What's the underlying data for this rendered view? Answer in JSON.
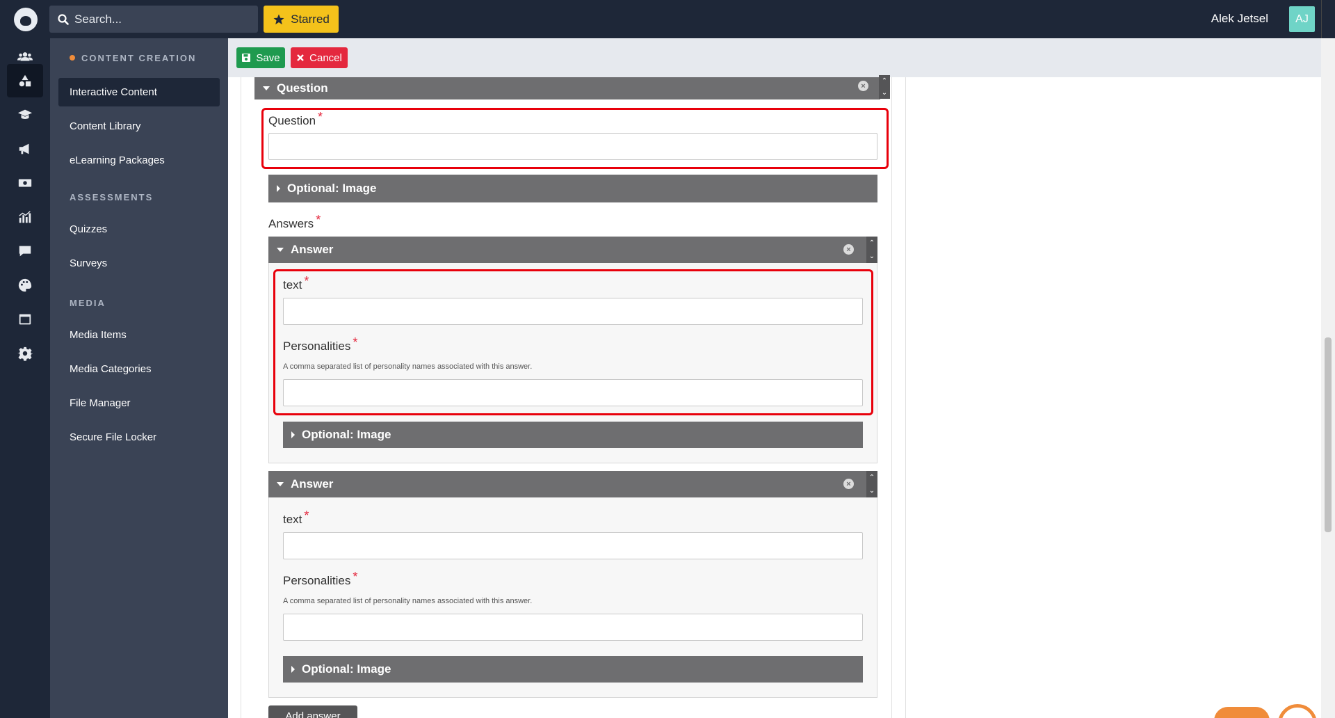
{
  "topbar": {
    "search_placeholder": "Search...",
    "starred_label": "Starred",
    "user_name": "Alek Jetsel",
    "user_initials": "AJ"
  },
  "rail": {
    "icons": [
      "users-icon",
      "shapes-icon",
      "graduation-cap-icon",
      "megaphone-icon",
      "money-icon",
      "chart-icon",
      "chat-icon",
      "palette-icon",
      "window-icon",
      "gear-icon"
    ]
  },
  "sidebar": {
    "section_content": "CONTENT CREATION",
    "item_interactive": "Interactive Content",
    "item_library": "Content Library",
    "item_elearning": "eLearning Packages",
    "section_assessments": "ASSESSMENTS",
    "item_quizzes": "Quizzes",
    "item_surveys": "Surveys",
    "section_media": "MEDIA",
    "item_media_items": "Media Items",
    "item_media_categories": "Media Categories",
    "item_file_manager": "File Manager",
    "item_secure_locker": "Secure File Locker"
  },
  "actions": {
    "save_label": "Save",
    "cancel_label": "Cancel"
  },
  "form": {
    "question_panel_title": "Question",
    "question_label": "Question",
    "optional_image_label": "Optional: Image",
    "answers_label": "Answers",
    "answer_panel_title": "Answer",
    "text_label": "text",
    "personalities_label": "Personalities",
    "personalities_hint": "A comma separated list of personality names associated with this answer.",
    "add_answer_label": "Add answer",
    "required_mark": "*"
  },
  "colors": {
    "topbar": "#1e2738",
    "sidebar": "#3a4355",
    "starred": "#f4c21b",
    "save": "#1f9a4f",
    "cancel": "#e4283e",
    "panel_head": "#6e6e70",
    "highlight": "#e8000b",
    "accent": "#f08c3a"
  }
}
